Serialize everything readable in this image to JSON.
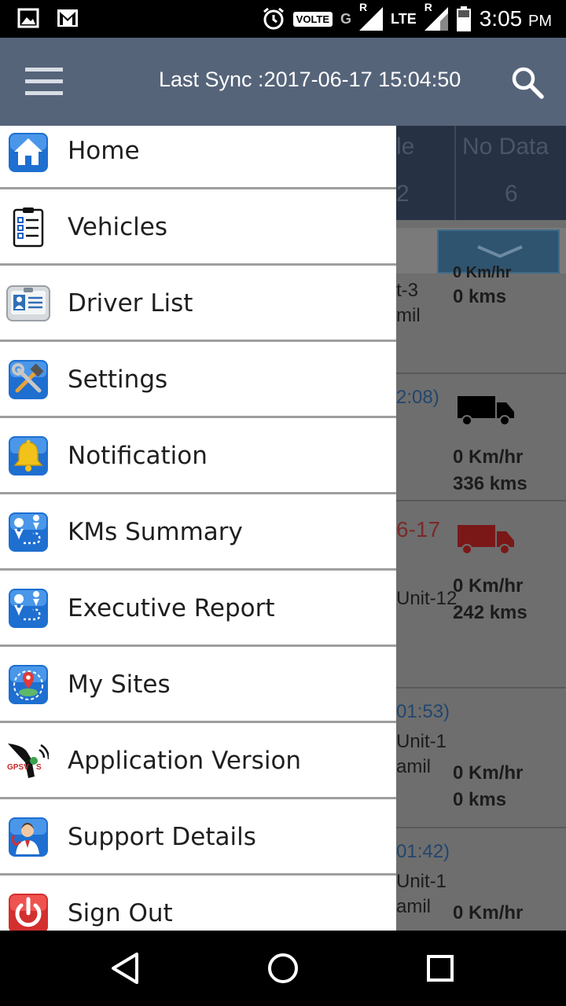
{
  "status_bar": {
    "volte": "VOLTE",
    "network_g": "G",
    "roaming_1": "R",
    "network_lte": "LTE",
    "roaming_2": "R",
    "time": "3:05",
    "ampm": "PM",
    "left_icons": [
      "image-notification-icon",
      "gmail-icon"
    ],
    "right_icons": [
      "alarm-icon",
      "signal-icon",
      "battery-icon"
    ]
  },
  "app_bar": {
    "sync_text": "Last Sync :2017-06-17 15:04:50",
    "menu_icon": "hamburger-menu-icon",
    "search_icon": "search-icon"
  },
  "colors": {
    "app_bar": "#56647a",
    "drawer_bg": "#ffffff",
    "divider": "#9e9e9e",
    "scrim_content": "#6e6e6e"
  },
  "drawer": {
    "items": [
      {
        "label": "Home",
        "icon": "home-icon"
      },
      {
        "label": "Vehicles",
        "icon": "checklist-icon"
      },
      {
        "label": "Driver List",
        "icon": "id-card-icon"
      },
      {
        "label": "Settings",
        "icon": "tools-icon"
      },
      {
        "label": "Notification",
        "icon": "bell-icon"
      },
      {
        "label": "KMs Summary",
        "icon": "route-map-icon"
      },
      {
        "label": "Executive Report",
        "icon": "route-map-icon"
      },
      {
        "label": "My Sites",
        "icon": "location-globe-icon"
      },
      {
        "label": "Application Version",
        "icon": "gpsvts-logo-icon"
      },
      {
        "label": "Support Details",
        "icon": "support-agent-icon"
      },
      {
        "label": "Sign Out",
        "icon": "power-icon"
      }
    ]
  },
  "background": {
    "stats": [
      {
        "label": "le",
        "value": "2"
      },
      {
        "label": "No Data",
        "value": "6"
      }
    ],
    "rows": [
      {
        "t1": "t-3",
        "t2": "mil",
        "speed": "0 kms"
      },
      {
        "time": "2:08)",
        "speed": "0 Km/hr",
        "kms": "336 kms"
      },
      {
        "time": "6-17",
        "unit": "Unit-12",
        "speed": "0 Km/hr",
        "kms": "242 kms"
      },
      {
        "time": "01:53)",
        "unit": "Unit-1",
        "t2": "amil",
        "speed": "0 Km/hr",
        "kms": "0 kms"
      },
      {
        "time": "01:42)",
        "unit": "Unit-1",
        "t2": "amil",
        "speed": "0 Km/hr"
      }
    ],
    "partial_speed_top": "0 Km/hr"
  },
  "nav_bar": {
    "back": "back-triangle-icon",
    "home": "home-circle-icon",
    "recents": "recents-square-icon"
  }
}
